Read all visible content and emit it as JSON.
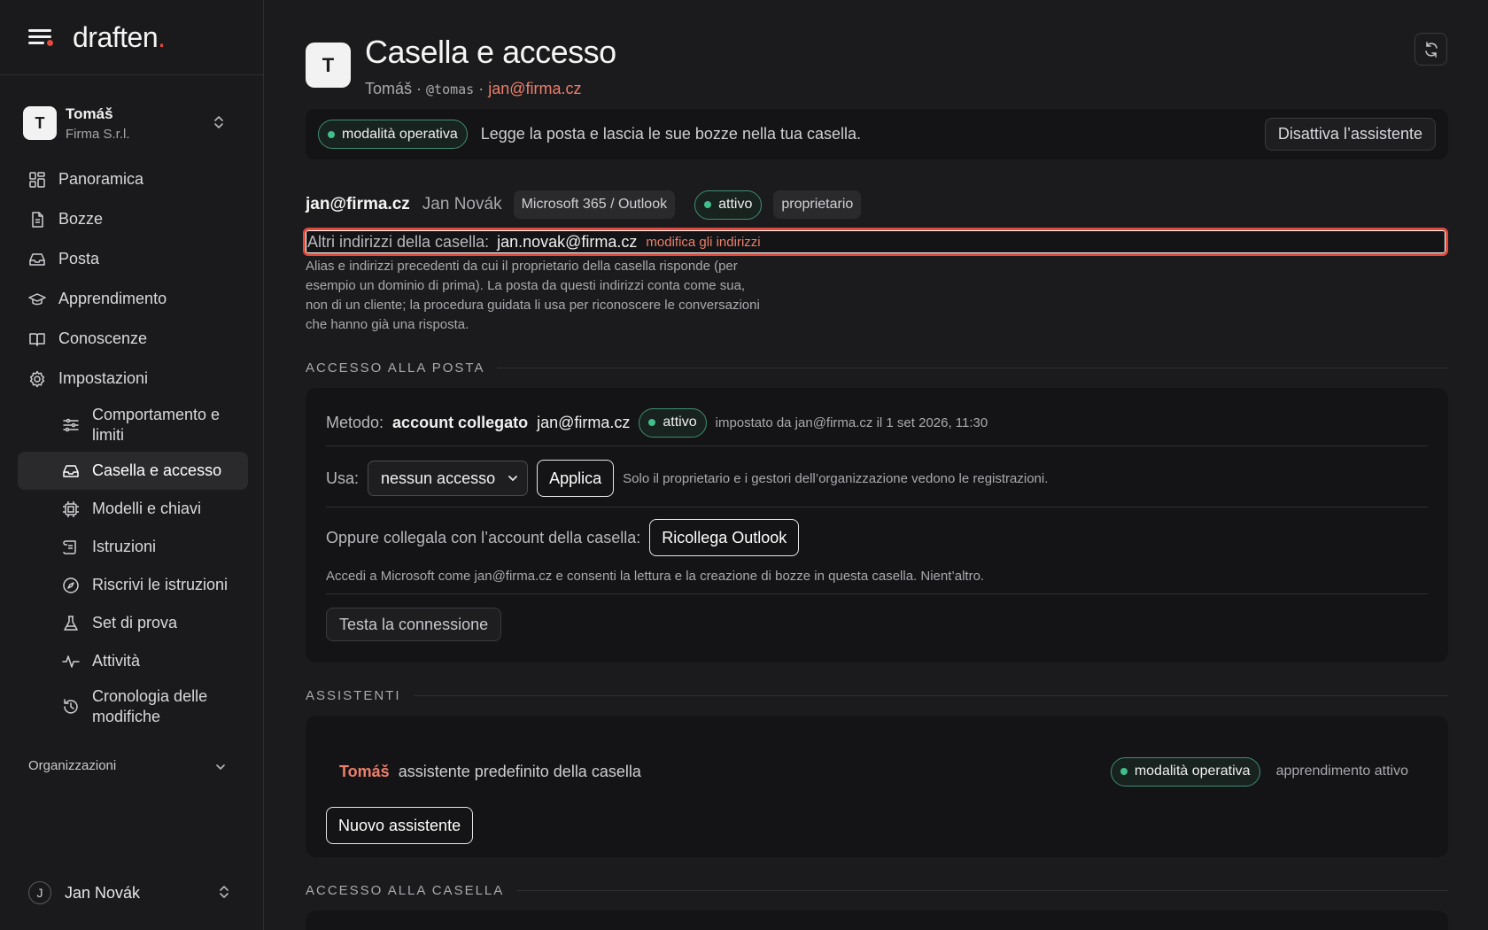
{
  "brand": {
    "name": "draften",
    "dot": ".",
    "accent_color": "#e24a3b"
  },
  "org_switch": {
    "initial": "T",
    "name": "Tomáš",
    "company": "Firma S.r.l."
  },
  "nav": {
    "items": [
      {
        "label": "Panoramica",
        "icon": "dashboard-grid-icon"
      },
      {
        "label": "Bozze",
        "icon": "document-icon"
      },
      {
        "label": "Posta",
        "icon": "inbox-icon"
      },
      {
        "label": "Apprendimento",
        "icon": "graduation-cap-icon"
      },
      {
        "label": "Conoscenze",
        "icon": "book-icon"
      },
      {
        "label": "Impostazioni",
        "icon": "gear-icon"
      }
    ],
    "settings_items": [
      {
        "label": "Comportamento e limiti",
        "icon": "sliders-icon"
      },
      {
        "label": "Casella e accesso",
        "icon": "inbox-icon",
        "active": true
      },
      {
        "label": "Modelli e chiavi",
        "icon": "chip-icon"
      },
      {
        "label": "Istruzioni",
        "icon": "scroll-icon"
      },
      {
        "label": "Riscrivi le istruzioni",
        "icon": "compass-icon"
      },
      {
        "label": "Set di prova",
        "icon": "flask-icon"
      },
      {
        "label": "Attività",
        "icon": "activity-icon"
      },
      {
        "label": "Cronologia delle modifiche",
        "icon": "history-icon"
      }
    ],
    "organizations_label": "Organizzazioni"
  },
  "user": {
    "initial": "J",
    "name": "Jan Novák"
  },
  "header": {
    "initial": "T",
    "title": "Casella e accesso",
    "name": "Tomáš",
    "sep": " · ",
    "handle": "@tomas",
    "email": "jan@firma.cz"
  },
  "mode_bar": {
    "pill": "modalità operativa",
    "text": "Legge la posta e lascia le sue bozze nella tua casella.",
    "disable_button": "Disattiva l’assistente"
  },
  "mailbox": {
    "email": "jan@firma.cz",
    "owner": "Jan Novák",
    "provider": "Microsoft 365 / Outlook",
    "status": "attivo",
    "role": "proprietario",
    "alt_label": "Altri indirizzi della casella:",
    "alt_value": "jan.novak@firma.cz",
    "alt_edit": "modifica gli indirizzi",
    "alt_help": "Alias e indirizzi precedenti da cui il proprietario della casella risponde (per esempio un dominio di prima). La posta da questi indirizzi conta come sua, non di un cliente; la procedura guidata li usa per riconoscere le conversazioni che hanno già una risposta."
  },
  "mail_access": {
    "section": "ACCESSO ALLA POSTA",
    "method_label": "Metodo:",
    "method_value": "account collegato",
    "method_email": "jan@firma.cz",
    "method_status": "attivo",
    "method_meta": "impostato da jan@firma.cz il 1 set 2026, 11:30",
    "use_label": "Usa:",
    "use_selected": "nessun accesso",
    "apply_button": "Applica",
    "use_note": "Solo il proprietario e i gestori dell’organizzazione vedono le registrazioni.",
    "reconnect_label": "Oppure collegala con l’account della casella:",
    "reconnect_button": "Ricollega Outlook",
    "reconnect_note": "Accedi a Microsoft come jan@firma.cz e consenti la lettura e la creazione di bozze in questa casella. Nient’altro.",
    "test_button": "Testa la connessione"
  },
  "assistants": {
    "section": "ASSISTENTI",
    "name": "Tomáš",
    "desc": "assistente predefinito della casella",
    "mode": "modalità operativa",
    "learning": "apprendimento attivo",
    "new_button": "Nuovo assistente"
  },
  "mailbox_access": {
    "section": "ACCESSO ALLA CASELLA"
  }
}
